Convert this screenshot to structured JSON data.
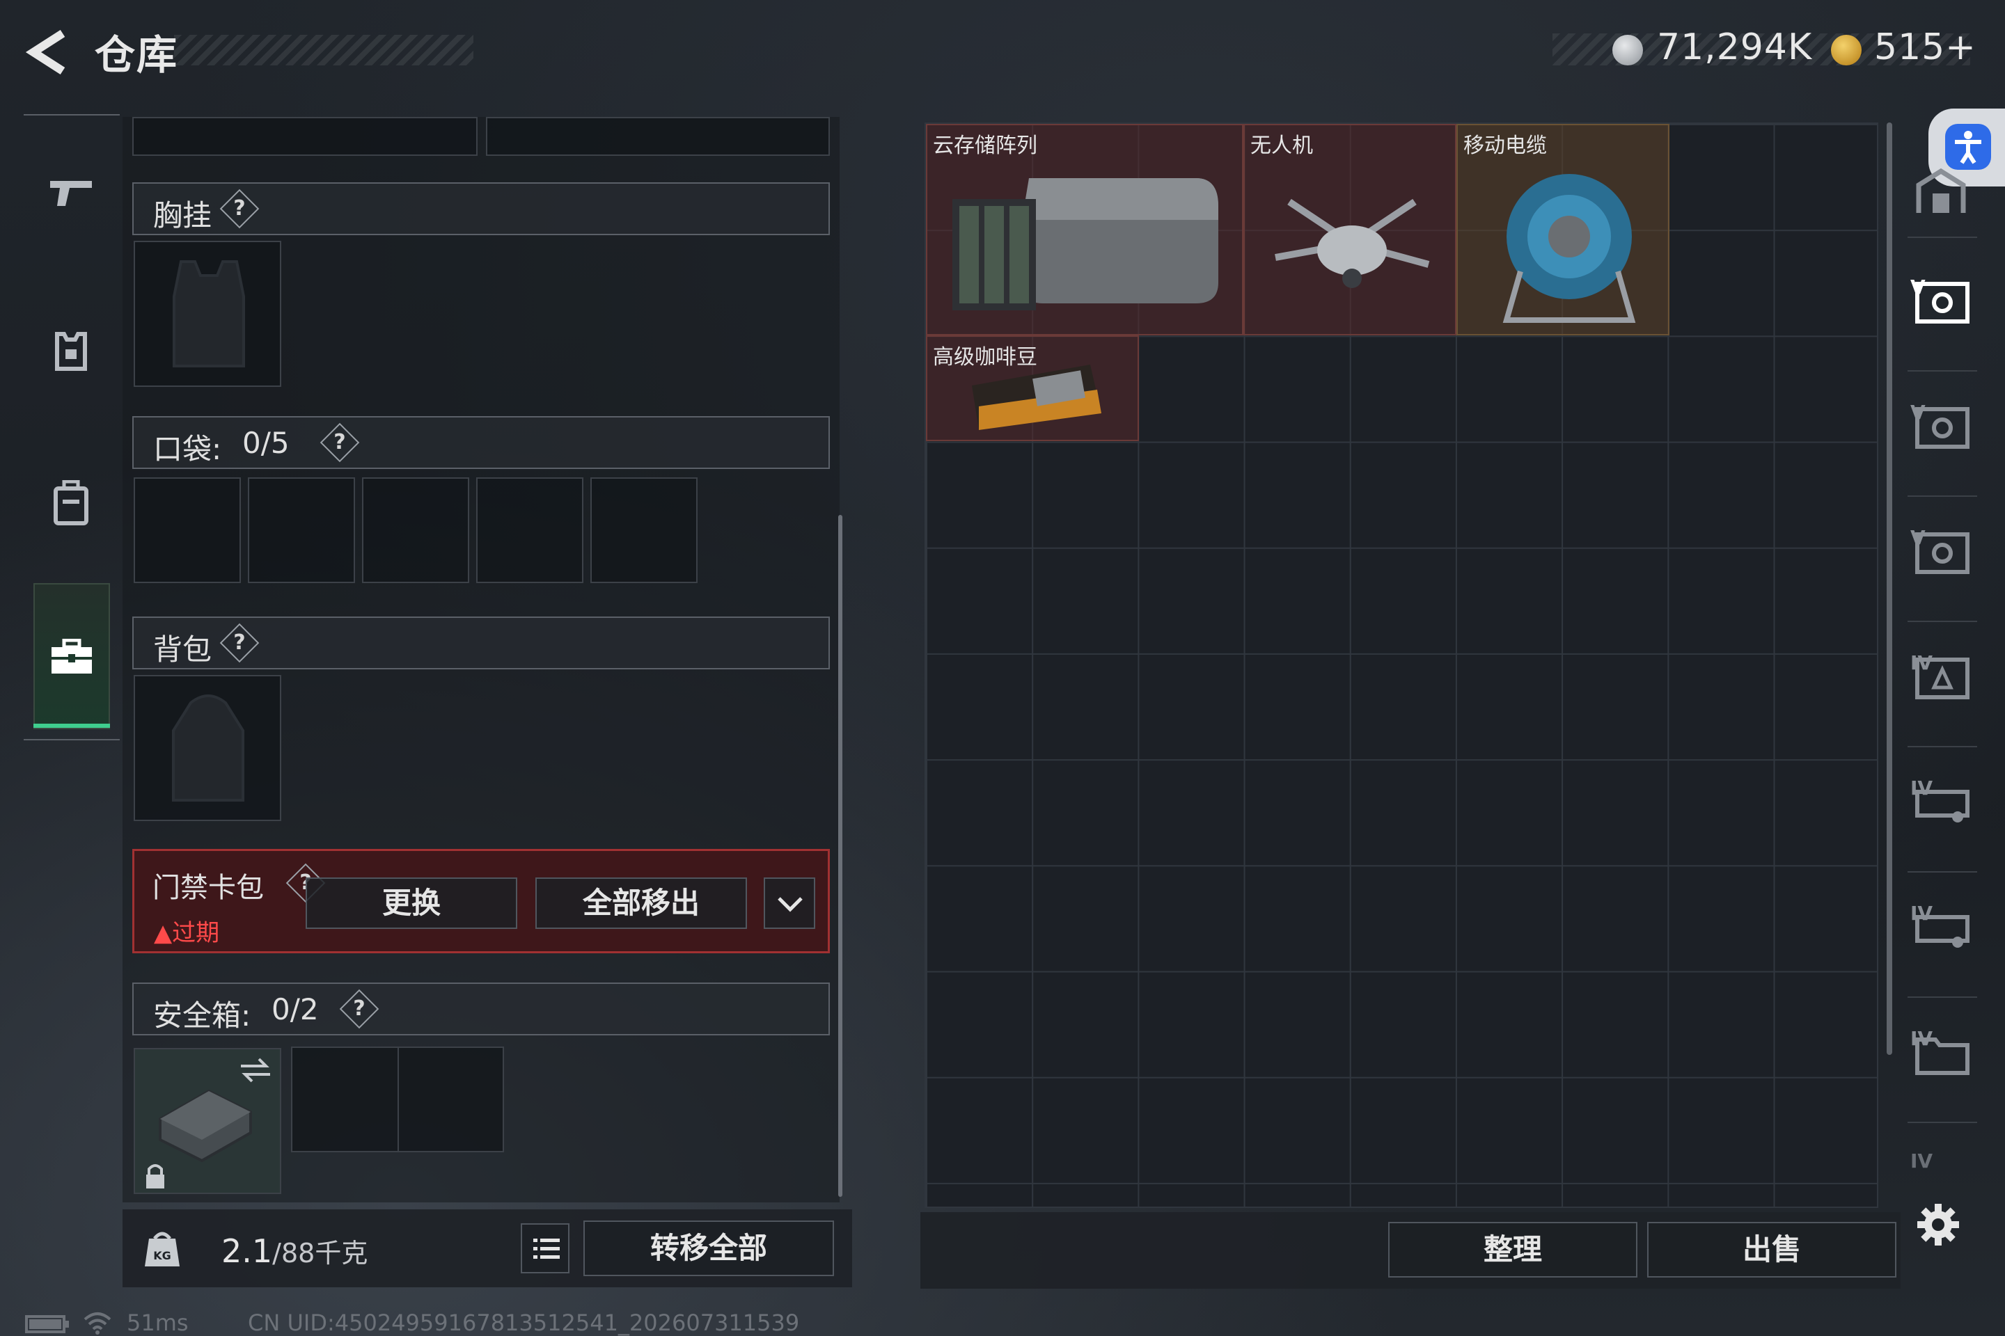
{
  "header": {
    "title": "仓库"
  },
  "currency": {
    "silver": "71,294K",
    "gold": "515+",
    "silver_color": "#b9bcc2",
    "gold_color": "#d6a02a"
  },
  "left_nav": [
    {
      "icon": "gun-icon"
    },
    {
      "icon": "armor-icon"
    },
    {
      "icon": "backpack-icon"
    },
    {
      "icon": "toolbox-icon",
      "active": true
    }
  ],
  "equipment": {
    "chest_rig": {
      "label": "胸挂",
      "help": "?"
    },
    "pockets": {
      "label": "口袋:",
      "count": "0/5",
      "help": "?"
    },
    "backpack": {
      "label": "背包",
      "help": "?"
    },
    "keycard": {
      "label": "门禁卡包",
      "help": "?",
      "status": "过期",
      "replace_label": "更换",
      "move_all_label": "全部移出"
    },
    "safe_box": {
      "label": "安全箱:",
      "count": "0/2",
      "help": "?"
    }
  },
  "bottom_left": {
    "weight": "2.1",
    "capacity": "/88千克",
    "transfer_all": "转移全部"
  },
  "warehouse_items": [
    {
      "name": "云存储阵列",
      "icon": "storage-array-icon"
    },
    {
      "name": "无人机",
      "icon": "drone-icon"
    },
    {
      "name": "移动电缆",
      "icon": "cable-reel-icon"
    },
    {
      "name": "高级咖啡豆",
      "icon": "coffee-bag-icon"
    }
  ],
  "bottom_right": {
    "organize": "整理",
    "sell": "出售"
  },
  "right_nav_labels": [
    "V",
    "V",
    "V",
    "IV",
    "IV",
    "IV",
    "IV",
    "IV"
  ],
  "status_bar": {
    "ping": "51ms",
    "uid": "CN UID:4502495916781351254​1_202607311539"
  }
}
